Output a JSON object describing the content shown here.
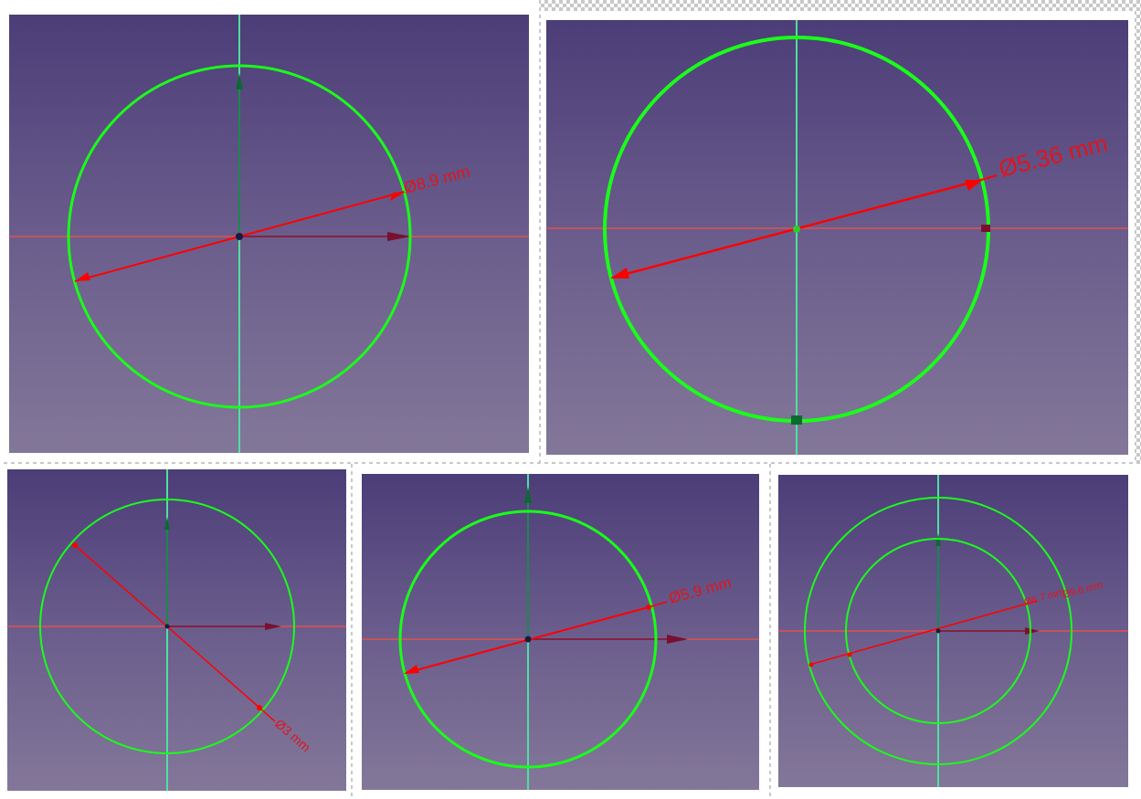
{
  "colors": {
    "sketch_geometry": "#19ff19",
    "dimension": "#ff0000",
    "horizontal_axis": "#e05050",
    "vertical_axis": "#4fe0a0",
    "x_arrow": "#7a1030",
    "y_arrow": "#0a6a30",
    "viewport_top": "#4c3d78",
    "viewport_bottom": "#837799"
  },
  "viewports": [
    {
      "name": "sketch-view-1",
      "dimensions": [
        {
          "label": "Ø8.9 mm"
        }
      ]
    },
    {
      "name": "sketch-view-2",
      "dimensions": [
        {
          "label": "Ø5.36 mm"
        }
      ]
    },
    {
      "name": "sketch-view-3",
      "dimensions": [
        {
          "label": "Ø3 mm"
        }
      ]
    },
    {
      "name": "sketch-view-4",
      "dimensions": [
        {
          "label": "Ø5.9 mm"
        }
      ]
    },
    {
      "name": "sketch-view-5",
      "dimensions": [
        {
          "label": "Ø6.7 mm"
        },
        {
          "label": "Ø9.6 mm"
        }
      ]
    }
  ]
}
